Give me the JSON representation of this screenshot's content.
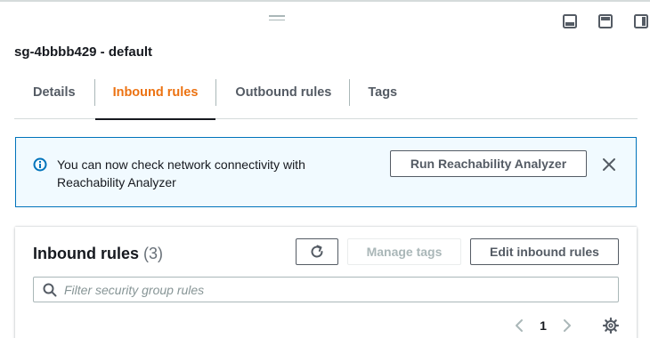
{
  "split_panel": {
    "title": "sg-4bbbb429 - default",
    "layout_icons": [
      "panel-bottom-icon",
      "panel-split-icon",
      "panel-side-icon"
    ]
  },
  "tabs": [
    {
      "label": "Details",
      "active": false
    },
    {
      "label": "Inbound rules",
      "active": true
    },
    {
      "label": "Outbound rules",
      "active": false
    },
    {
      "label": "Tags",
      "active": false
    }
  ],
  "banner": {
    "text": "You can now check network connectivity with Reachability Analyzer",
    "button_label": "Run Reachability Analyzer",
    "icon": "info-icon"
  },
  "inbound_card": {
    "title": "Inbound rules",
    "count": "(3)",
    "manage_tags_label": "Manage tags",
    "edit_label": "Edit inbound rules",
    "filter_placeholder": "Filter security group rules",
    "page_number": "1"
  },
  "colors": {
    "accent": "#ec7211",
    "info_border": "#0073bb",
    "info_bg": "#f1faff",
    "text": "#16191f"
  }
}
